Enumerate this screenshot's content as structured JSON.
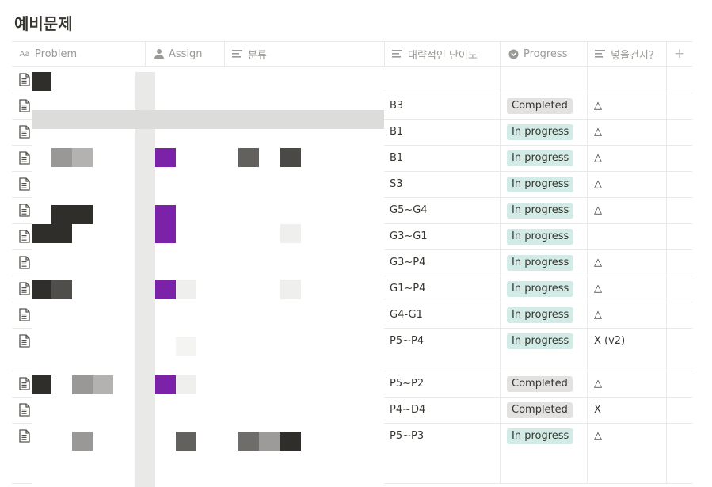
{
  "page": {
    "title": "예비문제"
  },
  "columns": {
    "problem": "Problem",
    "assign": "Assign",
    "category": "분류",
    "difficulty": "대략적인 난이도",
    "progress": "Progress",
    "include": "넣을건지?",
    "add": "+"
  },
  "rows": [
    {
      "difficulty": "",
      "progress": "",
      "include": ""
    },
    {
      "difficulty": "B3",
      "progress": "Completed",
      "include": "△"
    },
    {
      "difficulty": "B1",
      "progress": "In progress",
      "include": "△"
    },
    {
      "difficulty": "B1",
      "progress": "In progress",
      "include": "△"
    },
    {
      "difficulty": "S3",
      "progress": "In progress",
      "include": "△"
    },
    {
      "difficulty": "G5~G4",
      "progress": "In progress",
      "include": "△"
    },
    {
      "difficulty": "G3~G1",
      "progress": "In progress",
      "include": ""
    },
    {
      "difficulty": "G3~P4",
      "progress": "In progress",
      "include": "△"
    },
    {
      "difficulty": "G1~P4",
      "progress": "In progress",
      "include": "△"
    },
    {
      "difficulty": "G4-G1",
      "progress": "In progress",
      "include": "△"
    },
    {
      "difficulty": "P5~P4",
      "progress": "In progress",
      "include": "X (v2)"
    },
    {
      "difficulty": "P5~P2",
      "progress": "Completed",
      "include": "△"
    },
    {
      "difficulty": "P4~D4",
      "progress": "Completed",
      "include": "X"
    },
    {
      "difficulty": "P5~P3",
      "progress": "In progress",
      "include": "△"
    }
  ],
  "colors": {
    "in_progress": "#d3ebe6",
    "completed": "#e3e2e0",
    "assign_tag": "#7b22a8"
  }
}
